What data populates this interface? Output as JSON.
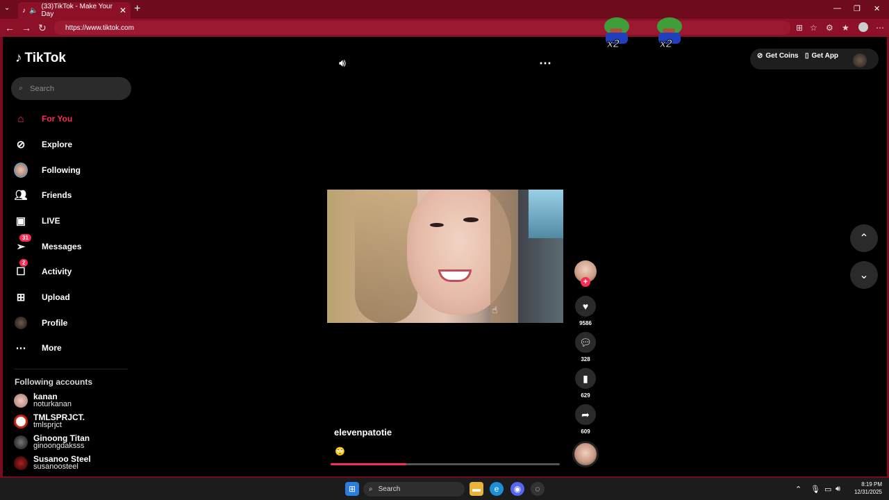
{
  "browser": {
    "tab_title": "(33)TikTok - Make Your Day",
    "url": "https://www.tiktok.com",
    "new_tab_label": "+"
  },
  "tiktok": {
    "logo_text": "TikTok",
    "search_placeholder": "Search",
    "nav": [
      {
        "label": "For You",
        "icon": "home-icon",
        "active": true
      },
      {
        "label": "Explore",
        "icon": "compass-icon"
      },
      {
        "label": "Following",
        "icon": "avatar-icon"
      },
      {
        "label": "Friends",
        "icon": "friends-icon"
      },
      {
        "label": "LIVE",
        "icon": "live-icon"
      },
      {
        "label": "Messages",
        "icon": "messages-icon",
        "badge": "31"
      },
      {
        "label": "Activity",
        "icon": "activity-icon",
        "badge": "2"
      },
      {
        "label": "Upload",
        "icon": "upload-icon"
      },
      {
        "label": "Profile",
        "icon": "profile-icon"
      },
      {
        "label": "More",
        "icon": "more-icon"
      }
    ],
    "following_title": "Following accounts",
    "following_accounts": [
      {
        "name": "kanan",
        "handle": "noturkanan"
      },
      {
        "name": "TMLSPRJCT.",
        "handle": "tmlsprjct"
      },
      {
        "name": "Ginoong Titan",
        "handle": "ginoongdaksss"
      },
      {
        "name": "Susanoo Steel",
        "handle": "susanoosteel"
      }
    ],
    "header": {
      "get_coins": "Get Coins",
      "get_app": "Get App"
    },
    "video": {
      "author": "elevenpatotie",
      "caption_emoji": "🙄",
      "progress": 0.33
    },
    "actions": {
      "likes": "9586",
      "comments": "328",
      "saves": "629",
      "shares": "609"
    },
    "stickers": [
      "x2",
      "x2"
    ]
  },
  "taskbar": {
    "search_label": "Search",
    "time": "8:19 PM",
    "date": "12/31/2025"
  },
  "colors": {
    "accent": "#fe2c55",
    "frame": "#7a0a1e"
  }
}
